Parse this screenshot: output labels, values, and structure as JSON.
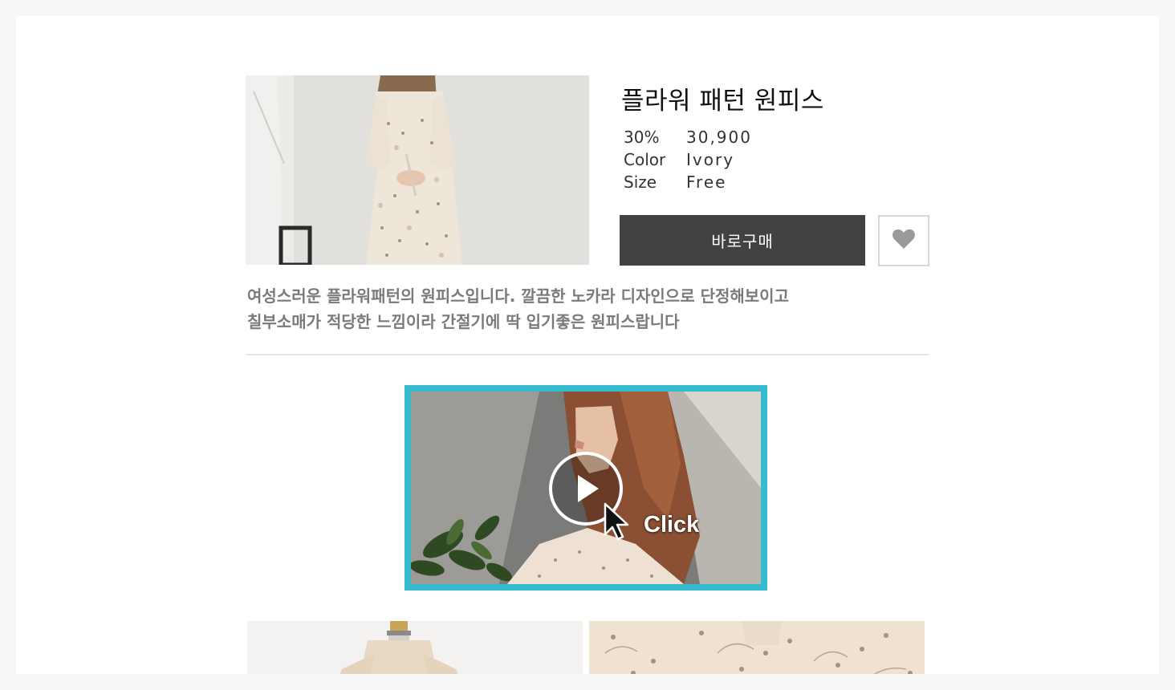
{
  "product": {
    "title": "플라워 패턴 원피스",
    "specs": [
      {
        "key": "30%",
        "value": "30,900"
      },
      {
        "key": "Color",
        "value": "Ivory"
      },
      {
        "key": "Size",
        "value": "Free"
      }
    ],
    "buy_label": "바로구매",
    "description_lines": [
      "여성스러운 플라워패턴의 원피스입니다. 깔끔한 노카라 디자인으로 단정해보이고",
      "칠부소매가 적당한 느낌이라 간절기에 딱 입기좋은 원피스랍니다"
    ]
  },
  "video": {
    "overlay_label": "Click"
  },
  "icons": {
    "wishlist": "heart-icon",
    "play": "play-icon",
    "cursor": "cursor-arrow-icon"
  },
  "colors": {
    "buy_button": "#424242",
    "video_border": "#35bccf",
    "heart": "#9a9a9a",
    "description_text": "#7a7a7a"
  }
}
